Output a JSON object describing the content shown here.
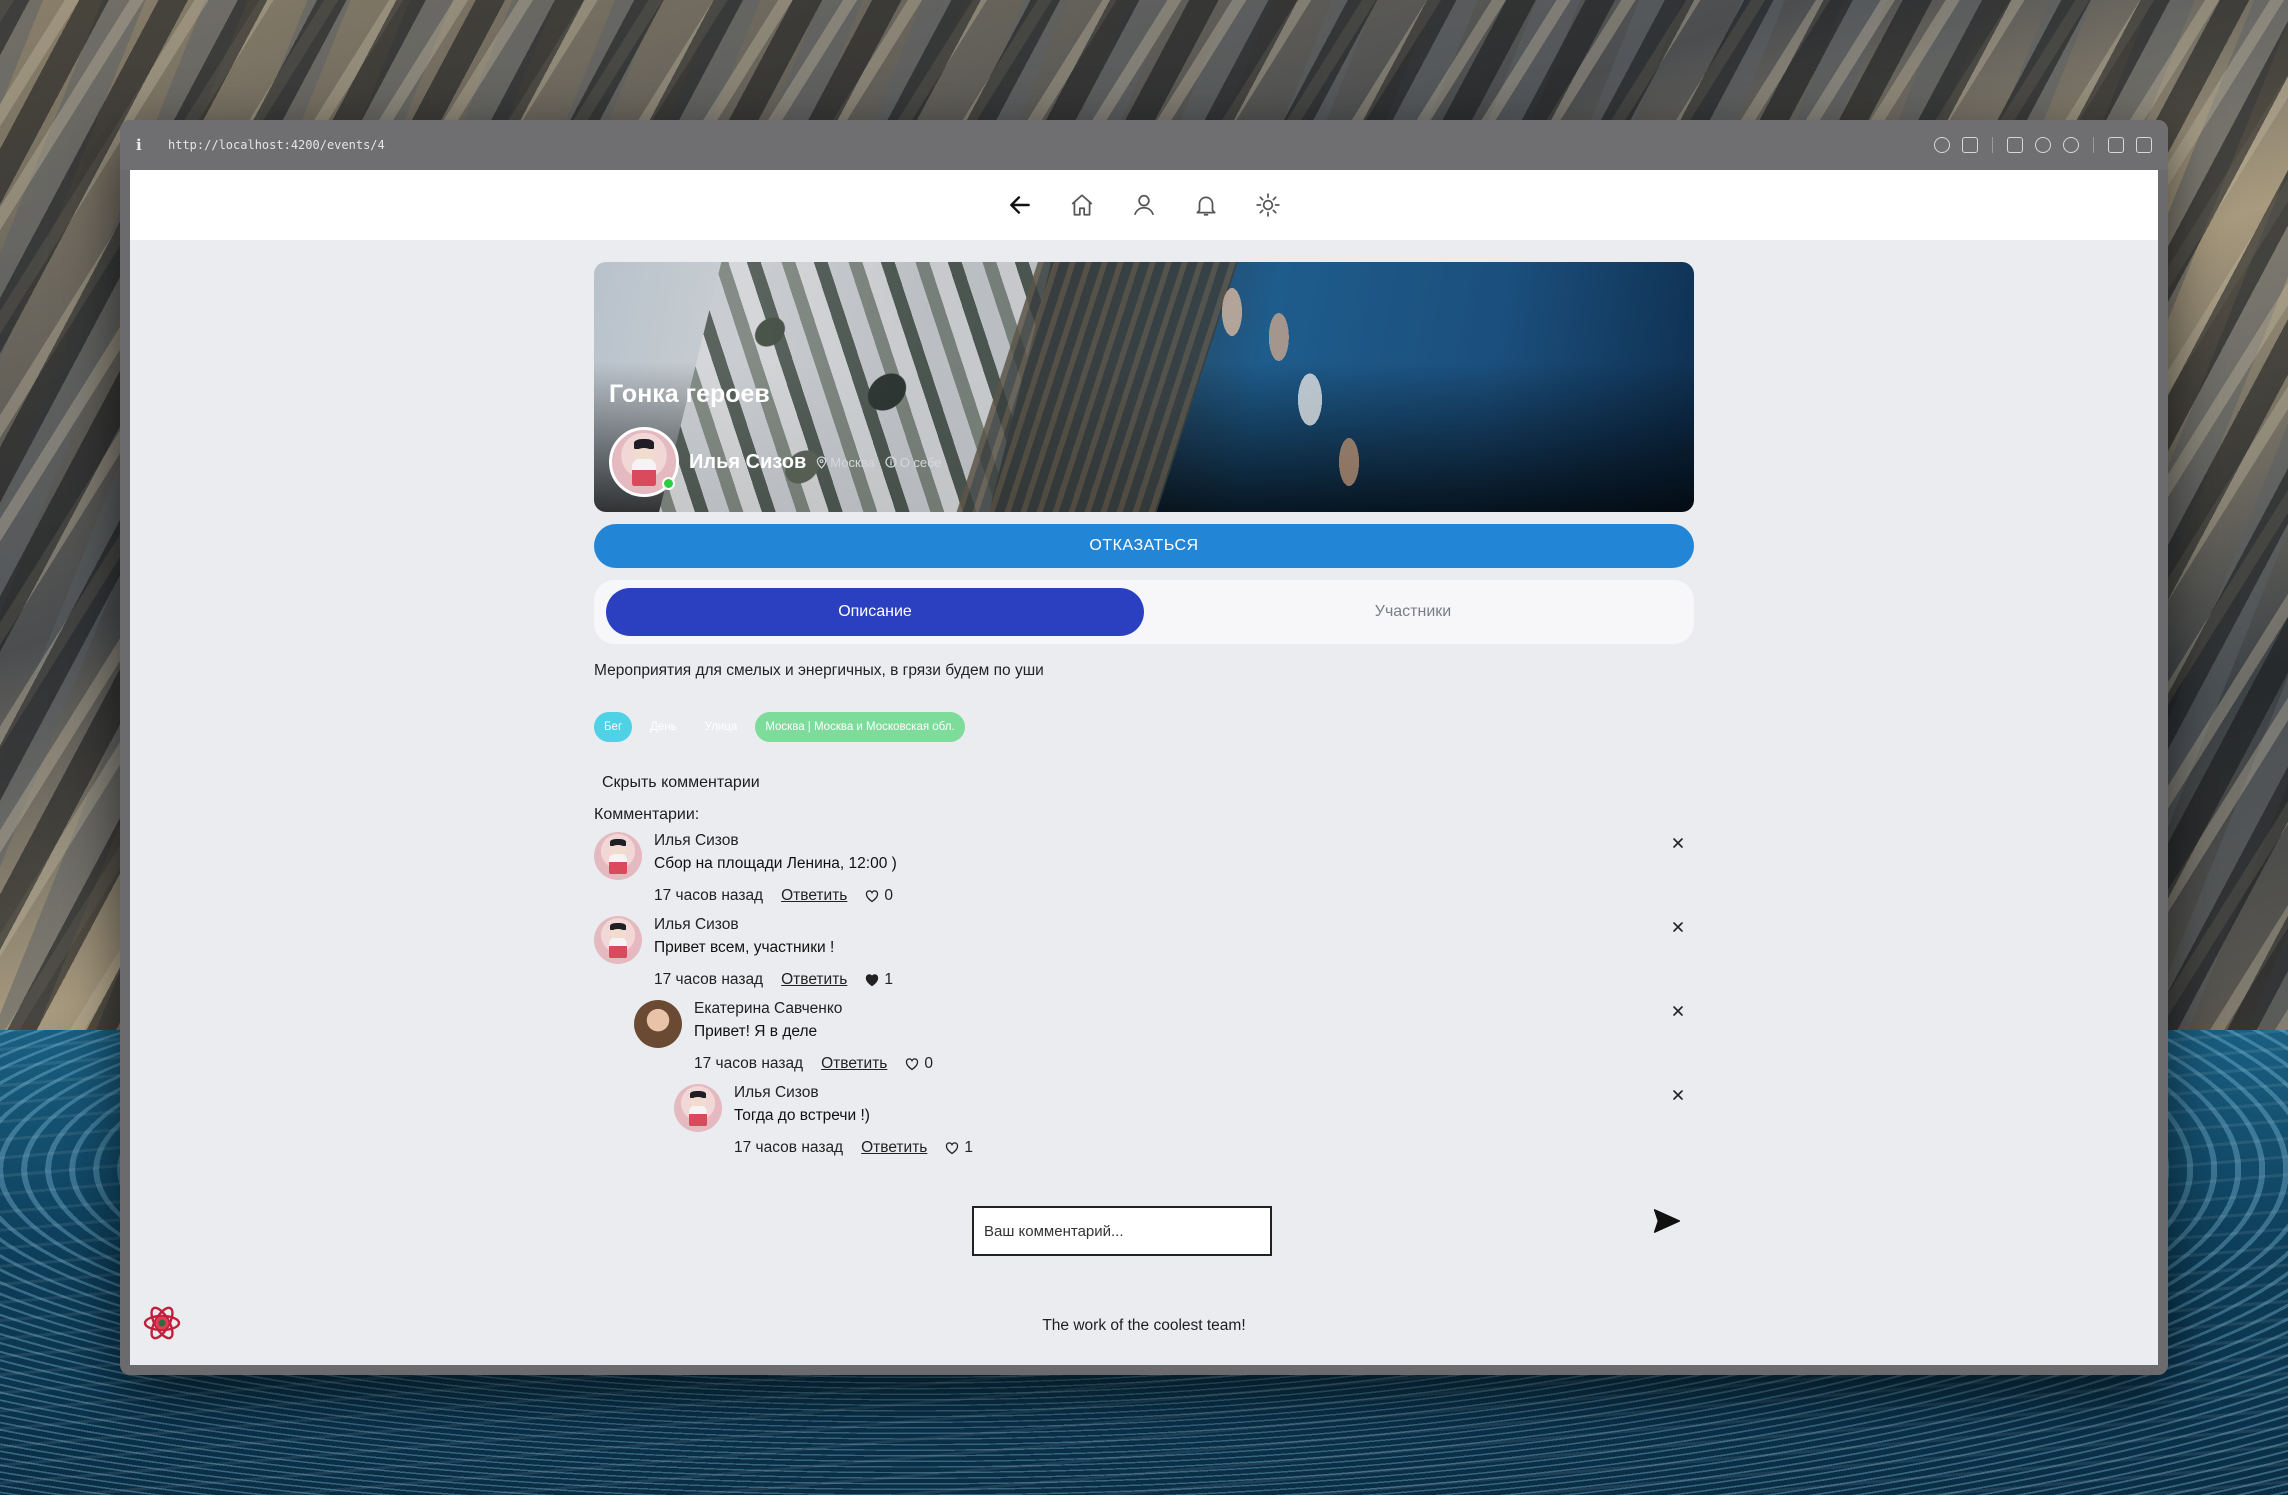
{
  "browser": {
    "url": "http://localhost:4200/events/4"
  },
  "event": {
    "title": "Гонка героев",
    "organizer": {
      "name": "Илья Сизов",
      "city": "Москва",
      "about": "О себе"
    },
    "refuse_label": "ОТКАЗАТЬСЯ",
    "tabs": [
      {
        "label": "Описание",
        "active": true
      },
      {
        "label": "Участники",
        "active": false
      }
    ],
    "description": "Мероприятия для смелых и энергичных, в грязи будем по уши",
    "tags": [
      {
        "label": "Бег",
        "color": "#4fd1e6"
      },
      {
        "label": "День",
        "color": "#ebecf0"
      },
      {
        "label": "Улица",
        "color": "#ebecf0"
      },
      {
        "label": "Москва | Москва и Московская обл.",
        "color": "#7ddc9a"
      }
    ]
  },
  "comments_section": {
    "hide_label": "Скрыть комментарии",
    "heading": "Комментарии:",
    "reply_label": "Ответить",
    "items": [
      {
        "author": "Илья Сизов",
        "text": "Сбор на площади Ленина, 12:00 )",
        "time": "17 часов назад",
        "likes": "0",
        "liked": false,
        "depth": 0
      },
      {
        "author": "Илья Сизов",
        "text": "Привет всем, участники !",
        "time": "17 часов назад",
        "likes": "1",
        "liked": true,
        "depth": 0
      },
      {
        "author": "Екатерина Савченко",
        "text": "Привет! Я в деле",
        "time": "17 часов назад",
        "likes": "0",
        "liked": false,
        "depth": 1
      },
      {
        "author": "Илья Сизов",
        "text": "Тогда до встречи !)",
        "time": "17 часов назад",
        "likes": "1",
        "liked": false,
        "depth": 2
      }
    ],
    "input_placeholder": "Ваш комментарий..."
  },
  "footer": {
    "text": "The work of the coolest team!"
  },
  "colors": {
    "accent_tab": "#2b3fc1",
    "refuse_button": "#2385d6",
    "online": "#2ecc40"
  },
  "icons": [
    "back-arrow-icon",
    "home-icon",
    "user-icon",
    "bell-icon",
    "sun-icon",
    "map-pin-icon",
    "info-icon",
    "heart-icon",
    "close-icon",
    "send-icon",
    "react-logo-icon"
  ]
}
